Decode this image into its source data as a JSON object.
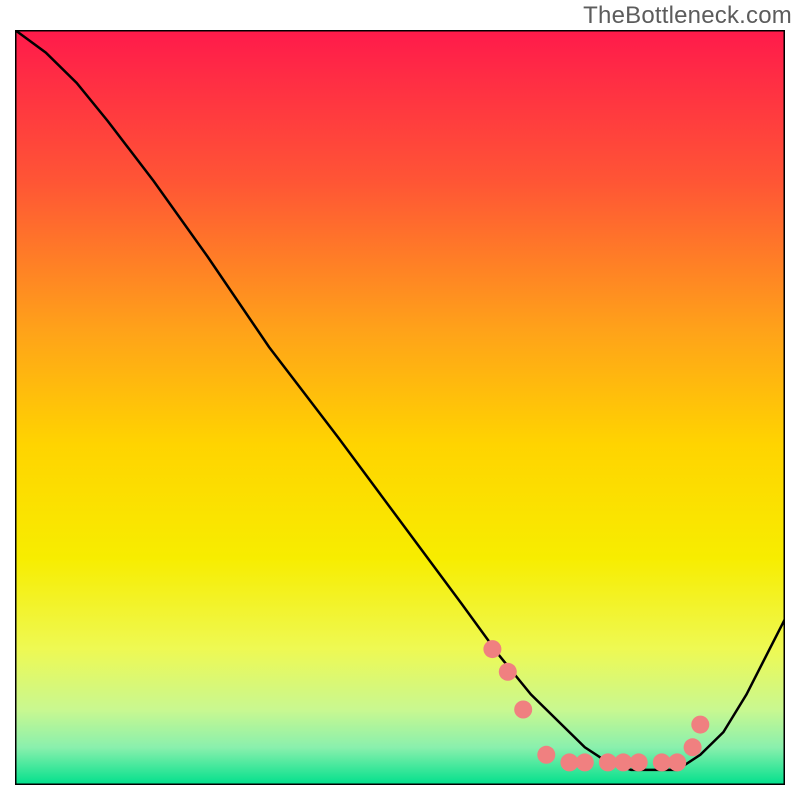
{
  "watermark": "TheBottleneck.com",
  "chart_data": {
    "type": "line",
    "title": "",
    "xlabel": "",
    "ylabel": "",
    "xlim": [
      0,
      100
    ],
    "ylim": [
      0,
      100
    ],
    "gradient_stops": [
      {
        "offset": 0.0,
        "color": "#ff1a4b"
      },
      {
        "offset": 0.2,
        "color": "#ff5535"
      },
      {
        "offset": 0.4,
        "color": "#ffa319"
      },
      {
        "offset": 0.55,
        "color": "#ffd400"
      },
      {
        "offset": 0.7,
        "color": "#f7ed00"
      },
      {
        "offset": 0.82,
        "color": "#eef953"
      },
      {
        "offset": 0.9,
        "color": "#c9f890"
      },
      {
        "offset": 0.95,
        "color": "#8af0ad"
      },
      {
        "offset": 1.0,
        "color": "#00e08c"
      }
    ],
    "series": [
      {
        "name": "curve",
        "x": [
          0,
          4,
          8,
          12,
          18,
          25,
          33,
          42,
          50,
          58,
          63,
          67,
          71,
          74,
          77,
          80,
          83,
          86,
          89,
          92,
          95,
          98,
          100
        ],
        "y": [
          100,
          97,
          93,
          88,
          80,
          70,
          58,
          46,
          35,
          24,
          17,
          12,
          8,
          5,
          3,
          2,
          2,
          2,
          4,
          7,
          12,
          18,
          22
        ]
      }
    ],
    "markers": {
      "name": "curve-markers",
      "color": "#f08080",
      "radius": 9,
      "x": [
        62,
        64,
        66,
        69,
        72,
        74,
        77,
        79,
        81,
        84,
        86,
        88,
        89
      ],
      "y": [
        18,
        15,
        10,
        4,
        3,
        3,
        3,
        3,
        3,
        3,
        3,
        5,
        8
      ]
    }
  }
}
